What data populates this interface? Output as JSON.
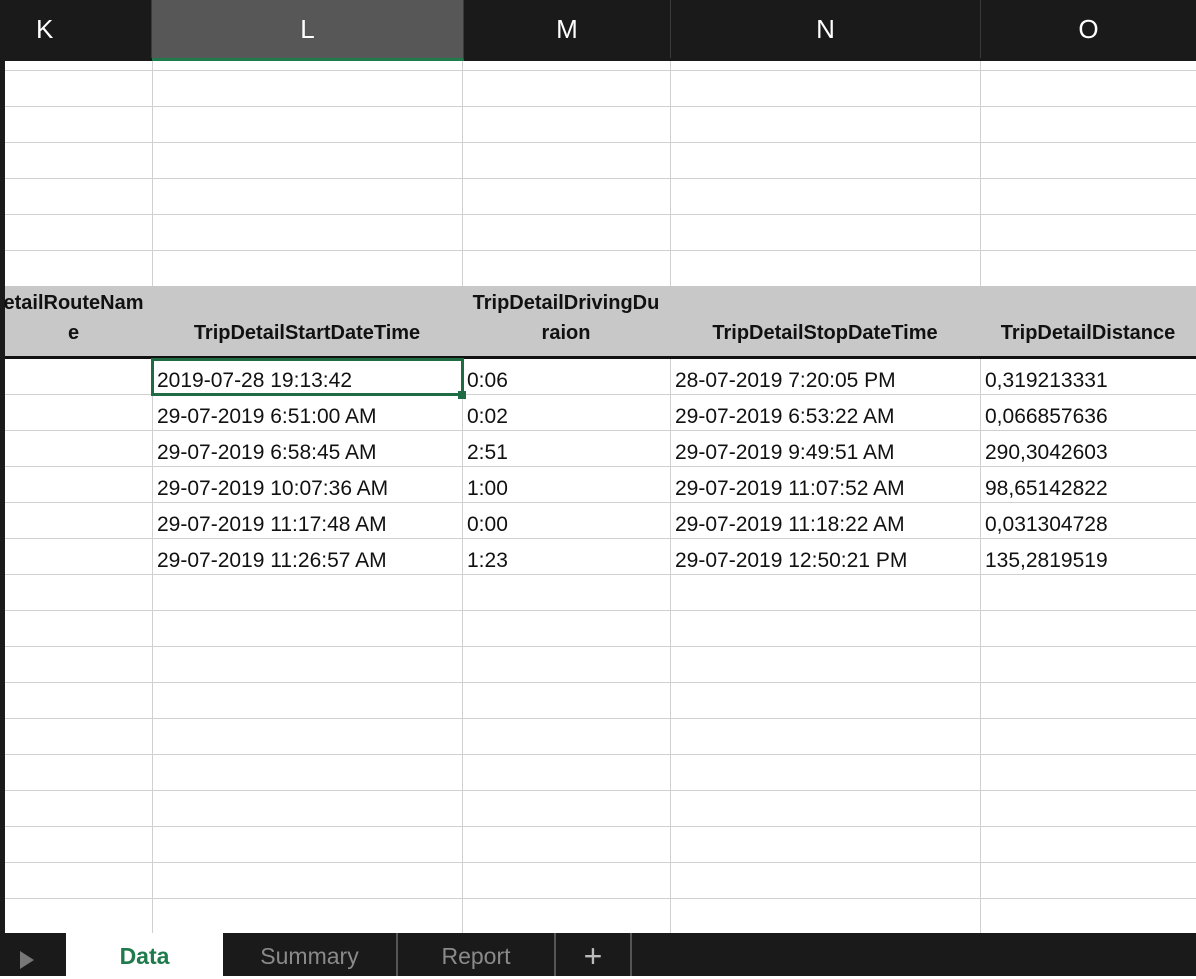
{
  "columns": [
    "K",
    "L",
    "M",
    "N",
    "O"
  ],
  "selected_column": "L",
  "headers": {
    "k": [
      "etailRouteNam",
      "e"
    ],
    "l": [
      "",
      "TripDetailStartDateTime"
    ],
    "m": [
      "TripDetailDrivingDu",
      "raion"
    ],
    "n": [
      "",
      "TripDetailStopDateTime"
    ],
    "o": [
      "",
      "TripDetailDistance"
    ]
  },
  "rows": [
    {
      "k": "",
      "l": "2019-07-28  19:13:42",
      "m": "0:06",
      "n": "28-07-2019 7:20:05 PM",
      "o": "0,319213331"
    },
    {
      "k": "",
      "l": "29-07-2019 6:51:00 AM",
      "m": "0:02",
      "n": "29-07-2019 6:53:22 AM",
      "o": "0,066857636"
    },
    {
      "k": "",
      "l": "29-07-2019 6:58:45 AM",
      "m": "2:51",
      "n": "29-07-2019 9:49:51 AM",
      "o": "290,3042603"
    },
    {
      "k": "",
      "l": "29-07-2019 10:07:36 AM",
      "m": "1:00",
      "n": "29-07-2019 11:07:52 AM",
      "o": "98,65142822"
    },
    {
      "k": "",
      "l": "29-07-2019 11:17:48 AM",
      "m": "0:00",
      "n": "29-07-2019 11:18:22 AM",
      "o": "0,031304728"
    },
    {
      "k": "",
      "l": "29-07-2019 11:26:57 AM",
      "m": "1:23",
      "n": "29-07-2019 12:50:21 PM",
      "o": "135,2819519"
    }
  ],
  "sheet_tabs": [
    "Data",
    "Summary",
    "Report"
  ],
  "active_tab": "Data",
  "add_sheet_label": "+",
  "colors": {
    "accent": "#1f7a4c",
    "header_bg": "#1a1a1a",
    "selected_col_bg": "#575757",
    "table_header_bg": "#c8c8c8",
    "grid": "#d0d0d0"
  }
}
